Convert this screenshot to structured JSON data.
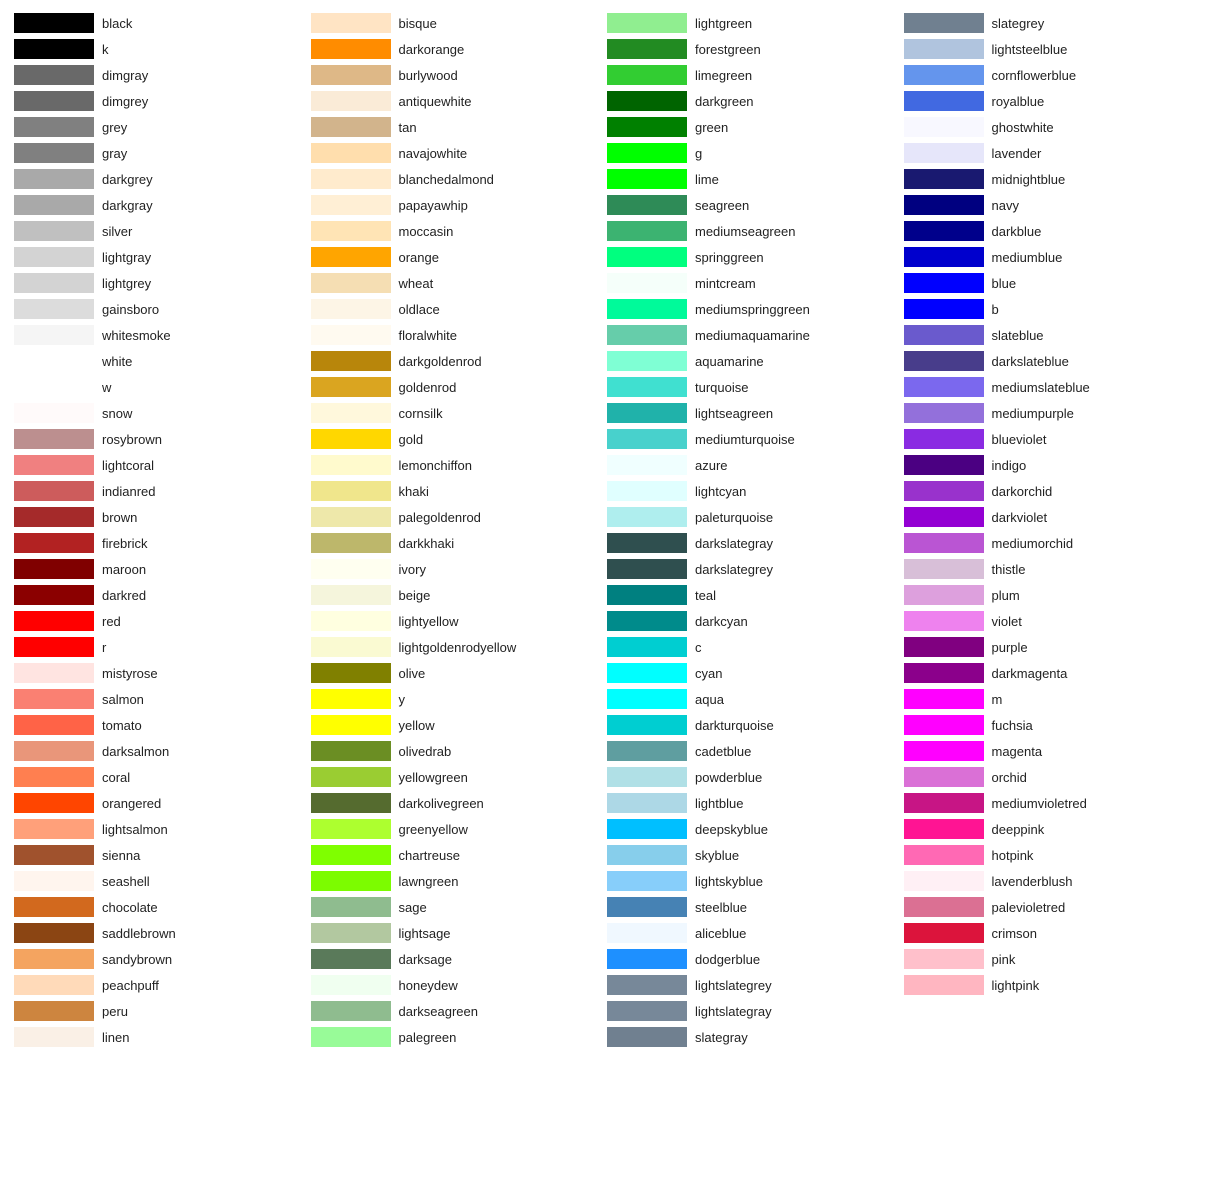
{
  "columns": [
    {
      "items": [
        {
          "color": "#000000",
          "name": "black"
        },
        {
          "color": "#000000",
          "name": "k"
        },
        {
          "color": "#696969",
          "name": "dimgray"
        },
        {
          "color": "#696969",
          "name": "dimgrey"
        },
        {
          "color": "#808080",
          "name": "grey"
        },
        {
          "color": "#808080",
          "name": "gray"
        },
        {
          "color": "#a9a9a9",
          "name": "darkgrey"
        },
        {
          "color": "#a9a9a9",
          "name": "darkgray"
        },
        {
          "color": "#c0c0c0",
          "name": "silver"
        },
        {
          "color": "#d3d3d3",
          "name": "lightgray"
        },
        {
          "color": "#d3d3d3",
          "name": "lightgrey"
        },
        {
          "color": "#dcdcdc",
          "name": "gainsboro"
        },
        {
          "color": "#f5f5f5",
          "name": "whitesmoke"
        },
        {
          "color": "#ffffff",
          "name": "white"
        },
        {
          "color": "#ffffff",
          "name": "w"
        },
        {
          "color": "#fffafa",
          "name": "snow"
        },
        {
          "color": "#bc8f8f",
          "name": "rosybrown"
        },
        {
          "color": "#f08080",
          "name": "lightcoral"
        },
        {
          "color": "#cd5c5c",
          "name": "indianred"
        },
        {
          "color": "#a52a2a",
          "name": "brown"
        },
        {
          "color": "#b22222",
          "name": "firebrick"
        },
        {
          "color": "#800000",
          "name": "maroon"
        },
        {
          "color": "#8b0000",
          "name": "darkred"
        },
        {
          "color": "#ff0000",
          "name": "red"
        },
        {
          "color": "#ff0000",
          "name": "r"
        },
        {
          "color": "#ffe4e1",
          "name": "mistyrose"
        },
        {
          "color": "#fa8072",
          "name": "salmon"
        },
        {
          "color": "#ff6347",
          "name": "tomato"
        },
        {
          "color": "#e9967a",
          "name": "darksalmon"
        },
        {
          "color": "#ff7f50",
          "name": "coral"
        },
        {
          "color": "#ff4500",
          "name": "orangered"
        },
        {
          "color": "#ffa07a",
          "name": "lightsalmon"
        },
        {
          "color": "#a0522d",
          "name": "sienna"
        },
        {
          "color": "#fff5ee",
          "name": "seashell"
        },
        {
          "color": "#d2691e",
          "name": "chocolate"
        },
        {
          "color": "#8b4513",
          "name": "saddlebrown"
        },
        {
          "color": "#f4a460",
          "name": "sandybrown"
        },
        {
          "color": "#ffdab9",
          "name": "peachpuff"
        },
        {
          "color": "#cd853f",
          "name": "peru"
        },
        {
          "color": "#faf0e6",
          "name": "linen"
        }
      ]
    },
    {
      "items": [
        {
          "color": "#ffe4c4",
          "name": "bisque"
        },
        {
          "color": "#ff8c00",
          "name": "darkorange"
        },
        {
          "color": "#deb887",
          "name": "burlywood"
        },
        {
          "color": "#faebd7",
          "name": "antiquewhite"
        },
        {
          "color": "#d2b48c",
          "name": "tan"
        },
        {
          "color": "#ffdead",
          "name": "navajowhite"
        },
        {
          "color": "#ffebcd",
          "name": "blanchedalmond"
        },
        {
          "color": "#ffefd5",
          "name": "papayawhip"
        },
        {
          "color": "#ffe4b5",
          "name": "moccasin"
        },
        {
          "color": "#ffa500",
          "name": "orange"
        },
        {
          "color": "#f5deb3",
          "name": "wheat"
        },
        {
          "color": "#fdf5e6",
          "name": "oldlace"
        },
        {
          "color": "#fffaf0",
          "name": "floralwhite"
        },
        {
          "color": "#b8860b",
          "name": "darkgoldenrod"
        },
        {
          "color": "#daa520",
          "name": "goldenrod"
        },
        {
          "color": "#fff8dc",
          "name": "cornsilk"
        },
        {
          "color": "#ffd700",
          "name": "gold"
        },
        {
          "color": "#fffacd",
          "name": "lemonchiffon"
        },
        {
          "color": "#f0e68c",
          "name": "khaki"
        },
        {
          "color": "#eee8aa",
          "name": "palegoldenrod"
        },
        {
          "color": "#bdb76b",
          "name": "darkkhaki"
        },
        {
          "color": "#fffff0",
          "name": "ivory"
        },
        {
          "color": "#f5f5dc",
          "name": "beige"
        },
        {
          "color": "#ffffe0",
          "name": "lightyellow"
        },
        {
          "color": "#fafad2",
          "name": "lightgoldenrodyellow"
        },
        {
          "color": "#808000",
          "name": "olive"
        },
        {
          "color": "#ffff00",
          "name": "y"
        },
        {
          "color": "#ffff00",
          "name": "yellow"
        },
        {
          "color": "#6b8e23",
          "name": "olivedrab"
        },
        {
          "color": "#9acd32",
          "name": "yellowgreen"
        },
        {
          "color": "#556b2f",
          "name": "darkolivegreen"
        },
        {
          "color": "#adff2f",
          "name": "greenyellow"
        },
        {
          "color": "#7fff00",
          "name": "chartreuse"
        },
        {
          "color": "#7cfc00",
          "name": "lawngreen"
        },
        {
          "color": "#8fbc8f",
          "name": "sage"
        },
        {
          "color": "#b2c8a0",
          "name": "lightsage"
        },
        {
          "color": "#5a7a5a",
          "name": "darksage"
        },
        {
          "color": "#f0fff0",
          "name": "honeydew"
        },
        {
          "color": "#8fbc8f",
          "name": "darkseagreen"
        },
        {
          "color": "#98fb98",
          "name": "palegreen"
        }
      ]
    },
    {
      "items": [
        {
          "color": "#90ee90",
          "name": "lightgreen"
        },
        {
          "color": "#228b22",
          "name": "forestgreen"
        },
        {
          "color": "#32cd32",
          "name": "limegreen"
        },
        {
          "color": "#006400",
          "name": "darkgreen"
        },
        {
          "color": "#008000",
          "name": "green"
        },
        {
          "color": "#00ff00",
          "name": "g"
        },
        {
          "color": "#00ff00",
          "name": "lime"
        },
        {
          "color": "#2e8b57",
          "name": "seagreen"
        },
        {
          "color": "#3cb371",
          "name": "mediumseagreen"
        },
        {
          "color": "#00ff7f",
          "name": "springgreen"
        },
        {
          "color": "#f5fffa",
          "name": "mintcream"
        },
        {
          "color": "#00fa9a",
          "name": "mediumspringgreen"
        },
        {
          "color": "#66cdaa",
          "name": "mediumaquamarine"
        },
        {
          "color": "#7fffd4",
          "name": "aquamarine"
        },
        {
          "color": "#40e0d0",
          "name": "turquoise"
        },
        {
          "color": "#20b2aa",
          "name": "lightseagreen"
        },
        {
          "color": "#48d1cc",
          "name": "mediumturquoise"
        },
        {
          "color": "#f0ffff",
          "name": "azure"
        },
        {
          "color": "#e0ffff",
          "name": "lightcyan"
        },
        {
          "color": "#afeeee",
          "name": "paleturquoise"
        },
        {
          "color": "#2f4f4f",
          "name": "darkslategray"
        },
        {
          "color": "#2f4f4f",
          "name": "darkslategrey"
        },
        {
          "color": "#008080",
          "name": "teal"
        },
        {
          "color": "#008b8b",
          "name": "darkcyan"
        },
        {
          "color": "#00ced1",
          "name": "c"
        },
        {
          "color": "#00ffff",
          "name": "cyan"
        },
        {
          "color": "#00ffff",
          "name": "aqua"
        },
        {
          "color": "#00ced1",
          "name": "darkturquoise"
        },
        {
          "color": "#5f9ea0",
          "name": "cadetblue"
        },
        {
          "color": "#b0e0e6",
          "name": "powderblue"
        },
        {
          "color": "#add8e6",
          "name": "lightblue"
        },
        {
          "color": "#00bfff",
          "name": "deepskyblue"
        },
        {
          "color": "#87ceeb",
          "name": "skyblue"
        },
        {
          "color": "#87cefa",
          "name": "lightskyblue"
        },
        {
          "color": "#4682b4",
          "name": "steelblue"
        },
        {
          "color": "#f0f8ff",
          "name": "aliceblue"
        },
        {
          "color": "#1e90ff",
          "name": "dodgerblue"
        },
        {
          "color": "#778899",
          "name": "lightslategrey"
        },
        {
          "color": "#778899",
          "name": "lightslategray"
        },
        {
          "color": "#708090",
          "name": "slategray"
        }
      ]
    },
    {
      "items": [
        {
          "color": "#708090",
          "name": "slategrey"
        },
        {
          "color": "#b0c4de",
          "name": "lightsteelblue"
        },
        {
          "color": "#6495ed",
          "name": "cornflowerblue"
        },
        {
          "color": "#4169e1",
          "name": "royalblue"
        },
        {
          "color": "#f8f8ff",
          "name": "ghostwhite"
        },
        {
          "color": "#e6e6fa",
          "name": "lavender"
        },
        {
          "color": "#191970",
          "name": "midnightblue"
        },
        {
          "color": "#000080",
          "name": "navy"
        },
        {
          "color": "#00008b",
          "name": "darkblue"
        },
        {
          "color": "#0000cd",
          "name": "mediumblue"
        },
        {
          "color": "#0000ff",
          "name": "blue"
        },
        {
          "color": "#0000ff",
          "name": "b"
        },
        {
          "color": "#6a5acd",
          "name": "slateblue"
        },
        {
          "color": "#483d8b",
          "name": "darkslateblue"
        },
        {
          "color": "#7b68ee",
          "name": "mediumslateblue"
        },
        {
          "color": "#9370db",
          "name": "mediumpurple"
        },
        {
          "color": "#8a2be2",
          "name": "blueviolet"
        },
        {
          "color": "#4b0082",
          "name": "indigo"
        },
        {
          "color": "#9932cc",
          "name": "darkorchid"
        },
        {
          "color": "#9400d3",
          "name": "darkviolet"
        },
        {
          "color": "#ba55d3",
          "name": "mediumorchid"
        },
        {
          "color": "#d8bfd8",
          "name": "thistle"
        },
        {
          "color": "#dda0dd",
          "name": "plum"
        },
        {
          "color": "#ee82ee",
          "name": "violet"
        },
        {
          "color": "#800080",
          "name": "purple"
        },
        {
          "color": "#8b008b",
          "name": "darkmagenta"
        },
        {
          "color": "#ff00ff",
          "name": "m"
        },
        {
          "color": "#ff00ff",
          "name": "fuchsia"
        },
        {
          "color": "#ff00ff",
          "name": "magenta"
        },
        {
          "color": "#da70d6",
          "name": "orchid"
        },
        {
          "color": "#c71585",
          "name": "mediumvioletred"
        },
        {
          "color": "#ff1493",
          "name": "deeppink"
        },
        {
          "color": "#ff69b4",
          "name": "hotpink"
        },
        {
          "color": "#fff0f5",
          "name": "lavenderblush"
        },
        {
          "color": "#db7093",
          "name": "palevioletred"
        },
        {
          "color": "#dc143c",
          "name": "crimson"
        },
        {
          "color": "#ffc0cb",
          "name": "pink"
        },
        {
          "color": "#ffb6c1",
          "name": "lightpink"
        },
        {
          "color": "#ffffff",
          "name": ""
        },
        {
          "color": "#ffffff",
          "name": ""
        }
      ]
    }
  ]
}
